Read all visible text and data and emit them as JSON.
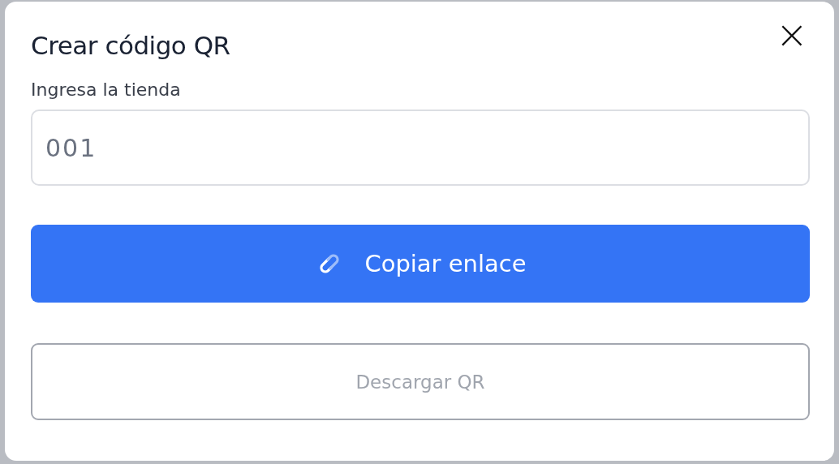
{
  "dialog": {
    "title": "Crear código QR",
    "close": "×"
  },
  "store_field": {
    "label": "Ingresa la tienda",
    "value": "001"
  },
  "buttons": [
    {
      "kind": "primary",
      "label": "Copiar enlace",
      "disabled": false
    },
    {
      "kind": "outline",
      "label": "Descargar QR",
      "disabled": true
    }
  ]
}
